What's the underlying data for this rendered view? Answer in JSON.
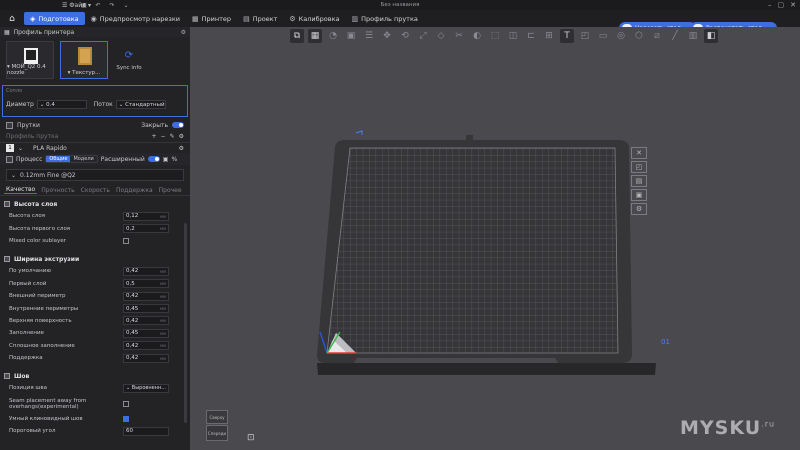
{
  "titlebar": {
    "menu_label": "Файл",
    "title": "Без названия"
  },
  "tabs": [
    {
      "label": "Подготовка",
      "icon": "cube-icon",
      "active": true
    },
    {
      "label": "Предпросмотр нарезки",
      "icon": "preview-icon",
      "active": false
    },
    {
      "label": "Принтер",
      "icon": "printer-icon",
      "active": false
    },
    {
      "label": "Проект",
      "icon": "project-icon",
      "active": false
    },
    {
      "label": "Калибровка",
      "icon": "calibration-icon",
      "active": false
    },
    {
      "label": "Профиль прутка",
      "icon": "filament-icon",
      "active": false
    }
  ],
  "actions": {
    "slice_label": "Нарезать стол",
    "print_label": "Распечатать стол",
    "accent": "#3d6fe0"
  },
  "printer": {
    "section_title": "Профиль принтера",
    "printer_name": "МОЙ_Q2 0.4 nozzle",
    "plate_name": "Текстур...",
    "sync_label": "Sync info"
  },
  "nozzle": {
    "caption": "Сопло",
    "diameter_label": "Диаметр",
    "diameter_value": "0.4",
    "flow_label": "Поток",
    "flow_value": "Стандартный"
  },
  "filament": {
    "title": "Прутки",
    "close_label": "Закрыть",
    "profile_placeholder": "Профиль прутка",
    "slot_number": "1",
    "slot_name": "PLA Rapido"
  },
  "process": {
    "title": "Процесс",
    "seg_global": "Общие",
    "seg_objects": "Модели",
    "advanced_label": "Расширенный",
    "preset": "0.12mm Fine @Q2",
    "tabs": [
      "Качество",
      "Прочность",
      "Скорость",
      "Поддержка",
      "Прочее"
    ]
  },
  "settings": {
    "layer_height": {
      "title": "Высота слоя",
      "rows": [
        {
          "label": "Высота слоя",
          "value": "0,12",
          "unit": "мм"
        },
        {
          "label": "Высота первого слоя",
          "value": "0,2",
          "unit": "мм"
        }
      ],
      "mixed_label": "Mixed color sublayer"
    },
    "line_width": {
      "title": "Ширина экструзии",
      "rows": [
        {
          "label": "По умолчанию",
          "value": "0,42",
          "unit": "мм"
        },
        {
          "label": "Первый слой",
          "value": "0,5",
          "unit": "мм"
        },
        {
          "label": "Внешний периметр",
          "value": "0,42",
          "unit": "мм"
        },
        {
          "label": "Внутренние периметры",
          "value": "0,45",
          "unit": "мм"
        },
        {
          "label": "Верхняя поверхность",
          "value": "0,42",
          "unit": "мм"
        },
        {
          "label": "Заполнение",
          "value": "0,45",
          "unit": "мм"
        },
        {
          "label": "Сплошное заполнение",
          "value": "0,42",
          "unit": "мм"
        },
        {
          "label": "Поддержка",
          "value": "0,42",
          "unit": "мм"
        }
      ]
    },
    "seam": {
      "title": "Шов",
      "position_label": "Позиция шва",
      "position_value": "Выровненн...",
      "away_label_1": "Seam placement away from",
      "away_label_2": "overhangs(experimental)",
      "smart_label": "Умный клиновидный шов",
      "threshold_label": "Пороговый угол",
      "threshold_value": "60"
    }
  },
  "viewport": {
    "plate_label": "01",
    "cube_top": "Сверху",
    "cube_front": "Спереди"
  },
  "watermark": {
    "text": "MYSKU",
    "suffix": ".ru"
  }
}
